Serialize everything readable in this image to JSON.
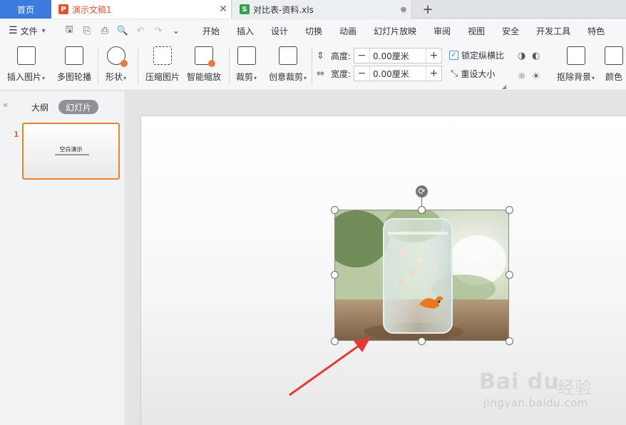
{
  "tabs": {
    "home": "首页",
    "active_doc": {
      "badge": "P",
      "badge_color": "#e5502e",
      "title": "演示文稿1",
      "close": "✕"
    },
    "other_doc": {
      "badge": "S",
      "badge_color": "#2fa14f",
      "title": "对比表-资料.xls",
      "dot": "●"
    },
    "new_tab": "+"
  },
  "menubar": {
    "file": "文件",
    "items": [
      "开始",
      "插入",
      "设计",
      "切换",
      "动画",
      "幻灯片放映",
      "审阅",
      "视图",
      "安全",
      "开发工具",
      "特色"
    ]
  },
  "ribbon": {
    "insert_image": "插入图片",
    "multi_image": "多图轮播",
    "shape": "形状",
    "compress": "压缩图片",
    "smart_scale": "智能缩放",
    "crop": "裁剪",
    "creative_crop": "创意裁剪",
    "height_label": "高度:",
    "height_value": "0.00厘米",
    "width_label": "宽度:",
    "width_value": "0.00厘米",
    "lock_ratio": "锁定纵横比",
    "reset_size": "重设大小",
    "remove_bg": "抠除背景",
    "color": "颜色"
  },
  "left_panel": {
    "tab_outline": "大纲",
    "tab_slides": "幻灯片",
    "slide_number": "1",
    "thumb_title": "空白演示"
  },
  "watermark": {
    "logo": "Bai du",
    "text": "经验",
    "url": "jingyan.baidu.com"
  },
  "colors": {
    "accent_blue": "#3b7be0",
    "accent_orange": "#e8832e",
    "arrow_red": "#e53a31"
  }
}
